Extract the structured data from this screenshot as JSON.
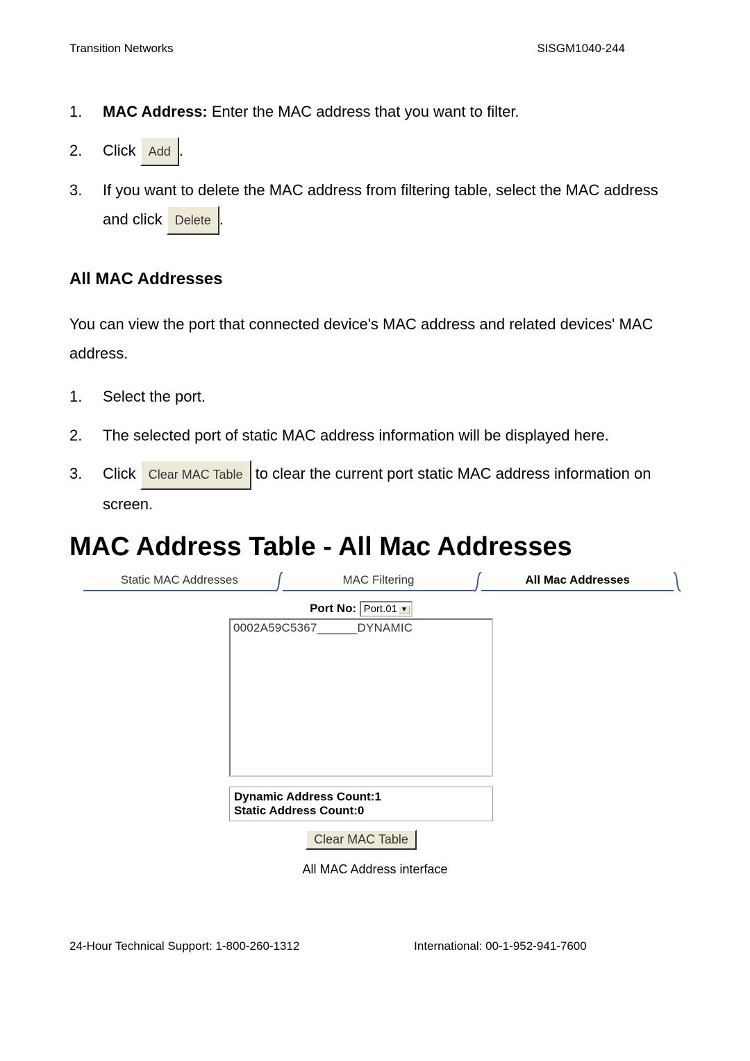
{
  "header": {
    "left": "Transition Networks",
    "right": "SISGM1040-244"
  },
  "steps_a": [
    {
      "num": "1.",
      "bold_lead": "MAC Address:",
      "rest": " Enter the MAC address that you want to filter."
    },
    {
      "num": "2.",
      "pre": "Click ",
      "btn": "Add",
      "post": "."
    },
    {
      "num": "3.",
      "pre": "If you want to delete the MAC address from filtering table, select the MAC address and click ",
      "btn": "Delete",
      "post": "."
    }
  ],
  "section_title": "All MAC Addresses",
  "paragraph": "You can view the port that connected device's MAC address and related devices' MAC address.",
  "steps_b": [
    {
      "num": "1.",
      "text": "Select the port."
    },
    {
      "num": "2.",
      "text": "The selected port of static MAC address information will be displayed here."
    },
    {
      "num": "3.",
      "pre": "Click  ",
      "btn": "Clear MAC Table",
      "post": "  to clear the current port static MAC address information on screen."
    }
  ],
  "big_title": "MAC Address Table - All Mac Addresses",
  "tabs": {
    "t1": "Static MAC Addresses",
    "t2": "MAC Filtering",
    "t3": "All Mac Addresses"
  },
  "port": {
    "label": "Port No:",
    "value": "Port.01"
  },
  "listbox": {
    "item1": "0002A59C5367______DYNAMIC"
  },
  "counts": {
    "dyn_label": "Dynamic Address Count:",
    "dyn_val": "1",
    "stat_label": "Static Address Count:",
    "stat_val": "0"
  },
  "clear_btn": "Clear MAC Table",
  "caption": "All MAC Address interface",
  "footer": {
    "left": "24-Hour Technical Support: 1-800-260-1312",
    "right": "International: 00-1-952-941-7600"
  }
}
